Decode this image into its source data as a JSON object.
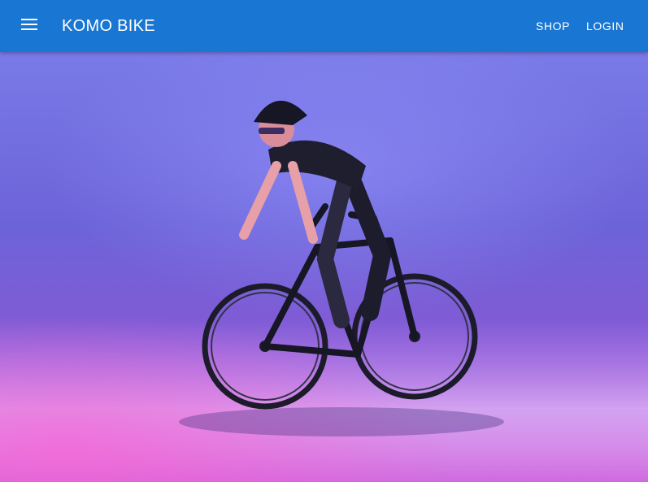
{
  "header": {
    "brand": "KOMO BIKE",
    "nav": [
      {
        "label": "SHOP"
      },
      {
        "label": "LOGIN"
      }
    ],
    "menu_icon": "menu-icon",
    "background": "#1976d2"
  },
  "hero": {
    "image": "cyclist-road-bike-photo"
  }
}
